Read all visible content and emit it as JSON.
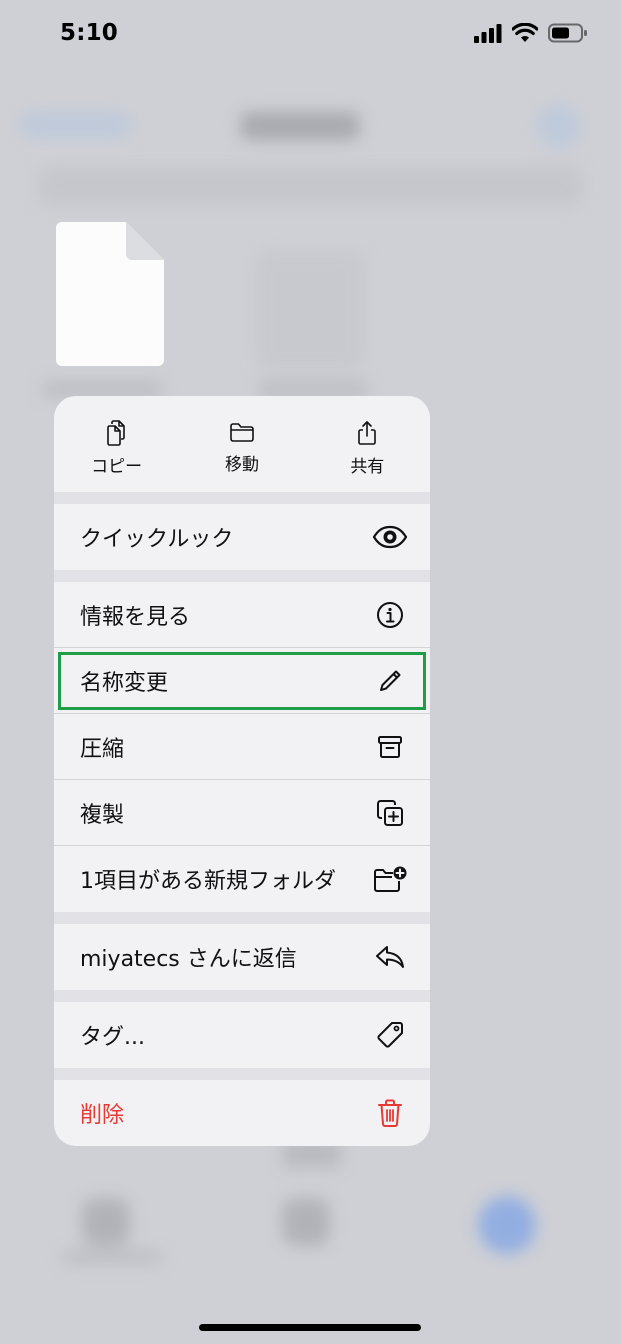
{
  "status_bar": {
    "time": "5:10"
  },
  "quick_actions": [
    {
      "label": "コピー",
      "icon": "copy-icon"
    },
    {
      "label": "移動",
      "icon": "folder-icon"
    },
    {
      "label": "共有",
      "icon": "share-icon"
    }
  ],
  "menu": {
    "quicklook": {
      "label": "クイックルック",
      "icon": "eye-icon"
    },
    "get_info": {
      "label": "情報を見る",
      "icon": "info-icon"
    },
    "rename": {
      "label": "名称変更",
      "icon": "pencil-icon"
    },
    "compress": {
      "label": "圧縮",
      "icon": "archive-box-icon"
    },
    "duplicate": {
      "label": "複製",
      "icon": "duplicate-icon"
    },
    "new_folder": {
      "label": "1項目がある新規フォルダ",
      "icon": "folder-plus-icon"
    },
    "reply": {
      "label": "miyatecs さんに返信",
      "icon": "reply-icon"
    },
    "tags": {
      "label": "タグ...",
      "icon": "tag-icon"
    },
    "delete": {
      "label": "削除",
      "icon": "trash-icon"
    }
  },
  "colors": {
    "menu_background": "#f2f2f4",
    "destructive": "#e53935",
    "highlight": "#1f9d47",
    "separator": "#e2e2e6"
  }
}
